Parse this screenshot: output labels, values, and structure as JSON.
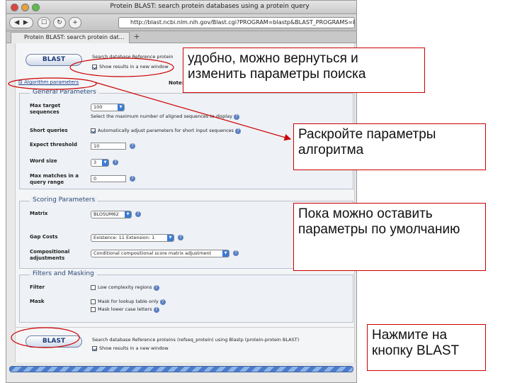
{
  "window": {
    "title": "Protein BLAST: search protein databases using a protein query",
    "url": "http://blast.ncbi.nlm.nih.gov/Blast.cgi?PROGRAM=blastp&BLAST_PROGRAMS=blastp&P",
    "tab_label": "Protein BLAST: search protein dat...",
    "new_tab": "+"
  },
  "top": {
    "blast_button": "BLAST",
    "search_text": "Search database Reference protein",
    "show_new_window": "Show results in a new window",
    "algorithm_link": "Algorithm parameters",
    "note": "Note: P"
  },
  "general": {
    "legend": "General Parameters",
    "max_target_label": "Max target sequences",
    "max_target_value": "100",
    "max_target_hint": "Select the maximum number of aligned sequences to display",
    "short_queries_label": "Short queries",
    "short_queries_text": "Automatically adjust parameters for short input sequences",
    "expect_label": "Expect threshold",
    "expect_value": "10",
    "word_size_label": "Word size",
    "word_size_value": "3",
    "max_matches_label": "Max matches in a query range",
    "max_matches_value": "0"
  },
  "scoring": {
    "legend": "Scoring Parameters",
    "matrix_label": "Matrix",
    "matrix_value": "BLOSUM62",
    "gap_label": "Gap Costs",
    "gap_value": "Existence: 11 Extension: 1",
    "comp_label": "Compositional adjustments",
    "comp_value": "Conditional compositional score matrix adjustment"
  },
  "filters": {
    "legend": "Filters and Masking",
    "filter_label": "Filter",
    "low_complexity": "Low complexity regions",
    "mask_label": "Mask",
    "mask_lookup": "Mask for lookup table only",
    "mask_lower": "Mask lower case letters"
  },
  "bottom": {
    "blast_button": "BLAST",
    "search_text": "Search database Reference proteins (refseq_protein) using Blastp (protein-protein BLAST)",
    "show_new_window": "Show results in a new window"
  },
  "callouts": {
    "c1": "удобно, можно вернуться и изменить параметры поиска",
    "c2": "Раскройте параметры алгоритма",
    "c3": " Пока можно оставить параметры по умолчанию",
    "c4": "Нажмите на кнопку BLAST"
  },
  "colors": {
    "annotation": "#cc0000",
    "link": "#1a3f8a",
    "progress": "#4a7cc9"
  }
}
